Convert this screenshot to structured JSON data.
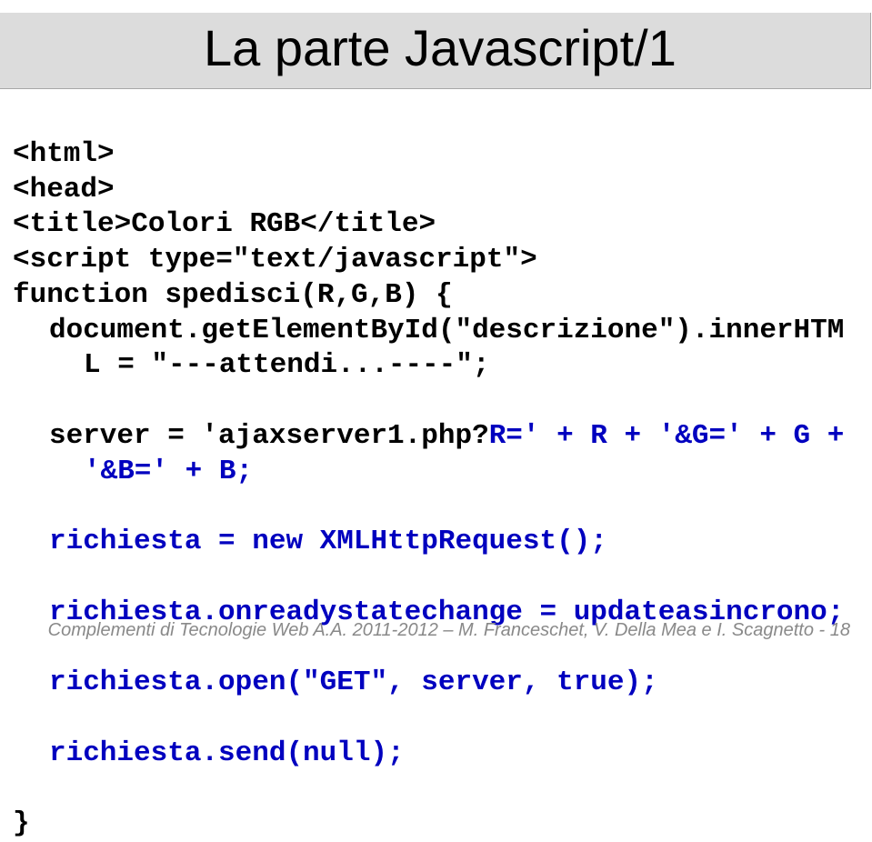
{
  "title": "La parte Javascript/1",
  "code": {
    "l1": "<html>",
    "l2": "<head>",
    "l3": "<title>Colori RGB</title>",
    "l4": "<script type=\"text/javascript\">",
    "l5": "function spedisci(R,G,B) {",
    "l6a": "document.getElementById(\"descrizione\").innerHTM",
    "l6b": "L = \"---attendi...----\";",
    "l7a": "server = 'ajaxserver1.php?",
    "l7b": "R=' + R + '&G=' + G + ",
    "l7c": "'&B=' + B;",
    "l8": "richiesta = new XMLHttpRequest();",
    "l9": "richiesta.onreadystatechange = updateasincrono;",
    "l10": "richiesta.open(\"GET\", server, true);",
    "l11": "richiesta.send(null);",
    "l12": "}"
  },
  "footer": "Complementi di Tecnologie Web A.A. 2011-2012 – M. Franceschet, V. Della Mea e I. Scagnetto - 18"
}
